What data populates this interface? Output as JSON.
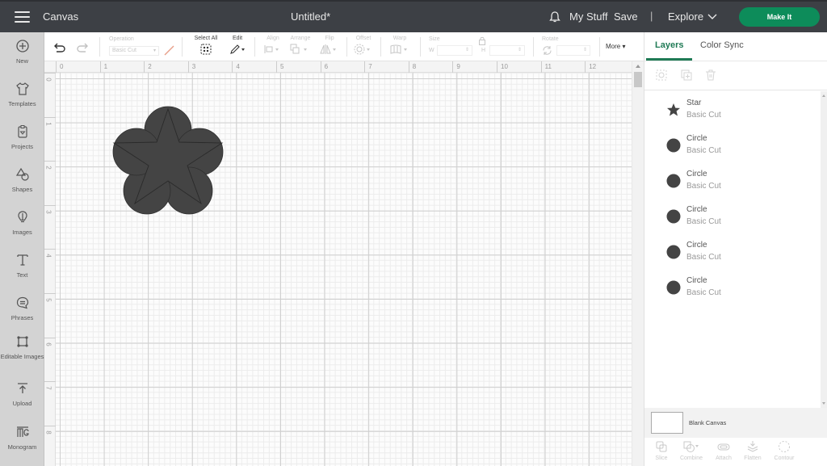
{
  "topbar": {
    "menu_icon": "hamburger-icon",
    "app_title": "Canvas",
    "doc_title": "Untitled*",
    "notifications_icon": "bell-icon",
    "my_stuff": "My Stuff",
    "save": "Save",
    "separator": "|",
    "explore": "Explore",
    "make_it": "Make It",
    "accent_color": "#0d8c5a"
  },
  "sidebar": {
    "items": [
      {
        "label": "New",
        "icon": "plus-circle-icon"
      },
      {
        "label": "Templates",
        "icon": "tshirt-icon"
      },
      {
        "label": "Projects",
        "icon": "projects-icon"
      },
      {
        "label": "Shapes",
        "icon": "shapes-icon"
      },
      {
        "label": "Images",
        "icon": "lightbulb-icon"
      },
      {
        "label": "Text",
        "icon": "text-icon"
      },
      {
        "label": "Phrases",
        "icon": "speech-bubble-icon"
      },
      {
        "label": "Editable Images",
        "icon": "editable-images-icon"
      },
      {
        "label": "Upload",
        "icon": "upload-icon"
      },
      {
        "label": "Monogram",
        "icon": "monogram-icon"
      }
    ]
  },
  "toolbar": {
    "operation_label": "Operation",
    "operation_value": "Basic Cut",
    "select_all_label": "Select All",
    "edit_label": "Edit",
    "align_label": "Align",
    "arrange_label": "Arrange",
    "flip_label": "Flip",
    "offset_label": "Offset",
    "warp_label": "Warp",
    "size_label": "Size",
    "width_prefix": "W",
    "height_prefix": "H",
    "rotate_label": "Rotate",
    "more_label": "More"
  },
  "rulers": {
    "horizontal": [
      "0",
      "1",
      "2",
      "3",
      "4",
      "5",
      "6",
      "7",
      "8",
      "9",
      "10",
      "11",
      "12"
    ],
    "vertical": [
      "0",
      "1",
      "2",
      "3",
      "4",
      "5",
      "6",
      "7",
      "8"
    ]
  },
  "panel": {
    "tabs": [
      {
        "label": "Layers",
        "active": true
      },
      {
        "label": "Color Sync",
        "active": false
      }
    ],
    "active_tab_color": "#1f7a55",
    "layers": [
      {
        "name": "Star",
        "operation": "Basic Cut",
        "icon": "star-icon"
      },
      {
        "name": "Circle",
        "operation": "Basic Cut",
        "icon": "circle-icon"
      },
      {
        "name": "Circle",
        "operation": "Basic Cut",
        "icon": "circle-icon"
      },
      {
        "name": "Circle",
        "operation": "Basic Cut",
        "icon": "circle-icon"
      },
      {
        "name": "Circle",
        "operation": "Basic Cut",
        "icon": "circle-icon"
      },
      {
        "name": "Circle",
        "operation": "Basic Cut",
        "icon": "circle-icon"
      }
    ],
    "layer_color": "#444444",
    "blank_canvas_label": "Blank Canvas",
    "bottom_tools": [
      {
        "label": "Slice",
        "icon": "slice-icon"
      },
      {
        "label": "Combine",
        "icon": "combine-icon"
      },
      {
        "label": "Attach",
        "icon": "attach-icon"
      },
      {
        "label": "Flatten",
        "icon": "flatten-icon"
      },
      {
        "label": "Contour",
        "icon": "contour-icon"
      }
    ]
  }
}
